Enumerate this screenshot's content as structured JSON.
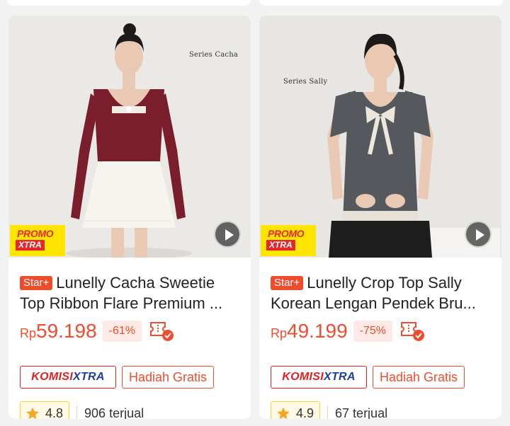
{
  "products": [
    {
      "series_text": "Series Cacha",
      "promo": {
        "line1": "PROMO",
        "line2": "XTRA"
      },
      "badge": "Star+",
      "title_line1": "Lunelly Cacha Sweetie",
      "title_line2": "Top Ribbon Flare Premium ...",
      "currency": "Rp",
      "price": "59.198",
      "discount": "-61%",
      "tag_komisi": {
        "part1": "KOMISI",
        "part2": "XTRA"
      },
      "tag_gift": "Hadiah Gratis",
      "rating": "4.8",
      "sold": "906 terjual",
      "top_color": "#7a1e2c",
      "bottom_color": "#f6f4ef"
    },
    {
      "series_text": "Series Sally",
      "promo": {
        "line1": "PROMO",
        "line2": "XTRA"
      },
      "badge": "Star+",
      "title_line1": "Lunelly Crop Top Sally",
      "title_line2": "Korean Lengan Pendek Bru...",
      "currency": "Rp",
      "price": "49.199",
      "discount": "-75%",
      "tag_komisi": {
        "part1": "KOMISI",
        "part2": "XTRA"
      },
      "tag_gift": "Hadiah Gratis",
      "rating": "4.9",
      "sold": "67 terjual",
      "top_color": "#55585c",
      "bottom_color": "#1e1e1e"
    }
  ],
  "colors": {
    "accent": "#ee4d2d",
    "star": "#f5a623",
    "komisi_red": "#e02020",
    "komisi_blue": "#1c3f9d"
  },
  "icons": {
    "play": "video-play-icon",
    "star": "star-icon",
    "voucher": "voucher-check-icon"
  }
}
